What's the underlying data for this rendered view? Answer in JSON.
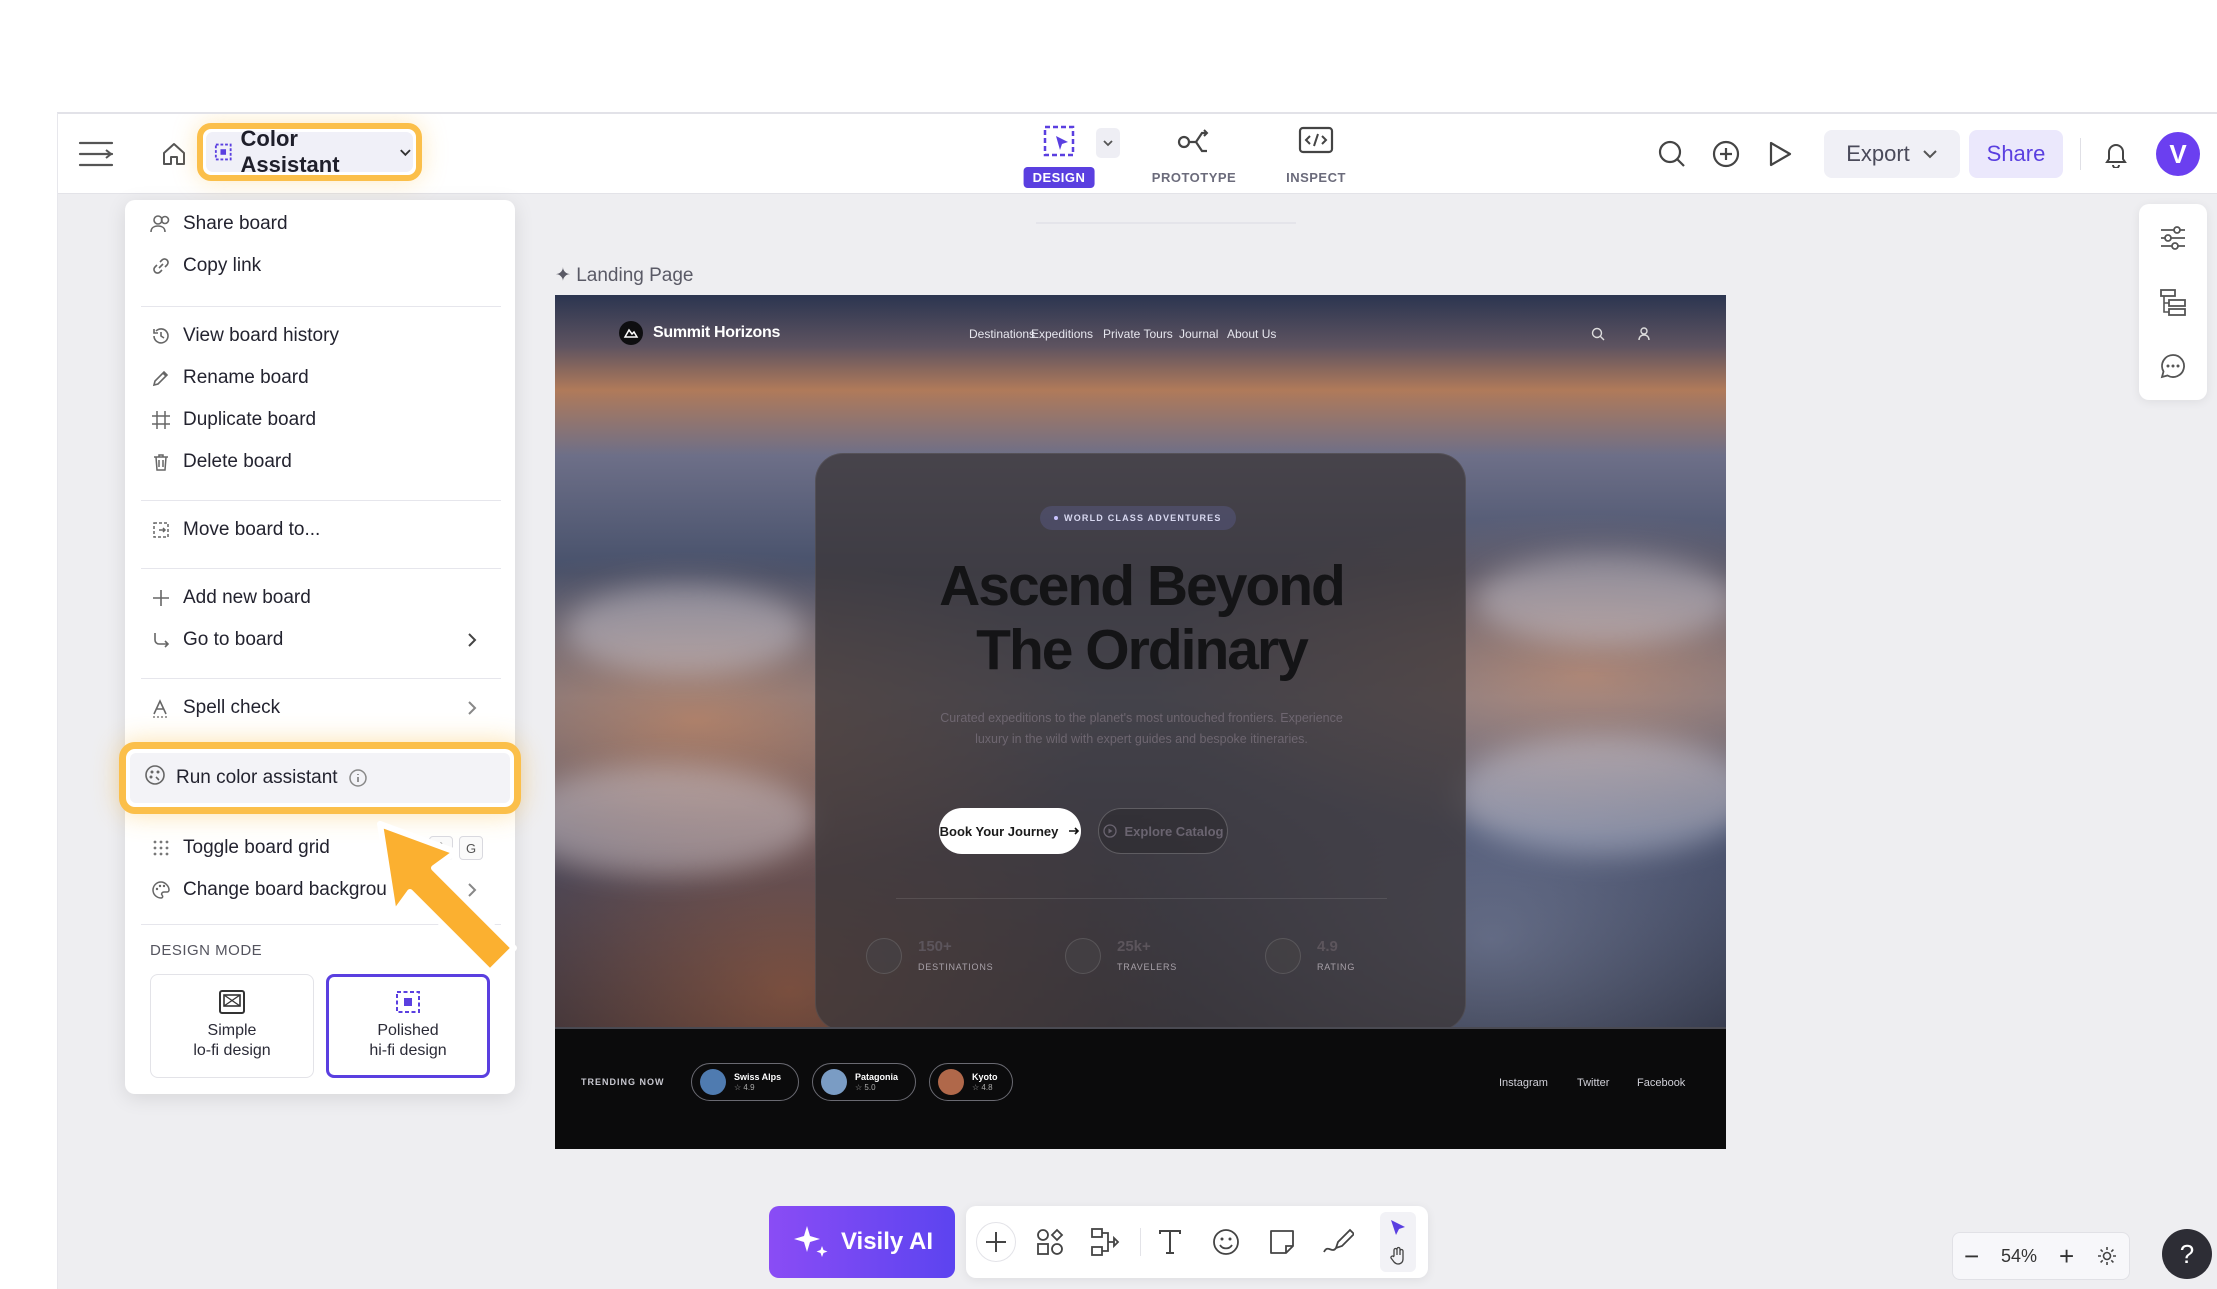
{
  "topbar": {
    "board_name": "Color Assistant",
    "modes": [
      {
        "label": "DESIGN",
        "active": true
      },
      {
        "label": "PROTOTYPE",
        "active": false
      },
      {
        "label": "INSPECT",
        "active": false
      }
    ],
    "export_label": "Export",
    "share_label": "Share",
    "avatar_initial": "V"
  },
  "menu": {
    "items": [
      {
        "label": "Share board",
        "icon": "share-users-icon"
      },
      {
        "label": "Copy link",
        "icon": "link-icon"
      },
      {
        "label": "View board history",
        "icon": "history-icon"
      },
      {
        "label": "Rename board",
        "icon": "pencil-icon"
      },
      {
        "label": "Duplicate board",
        "icon": "duplicate-icon"
      },
      {
        "label": "Delete board",
        "icon": "trash-icon"
      },
      {
        "label": "Move board to...",
        "icon": "move-icon"
      },
      {
        "label": "Add new board",
        "icon": "plus-icon"
      },
      {
        "label": "Go to board",
        "icon": "arrow-return-icon"
      },
      {
        "label": "Spell check",
        "icon": "spell-check-icon"
      },
      {
        "label": "Run color assistant",
        "icon": "color-palette-icon"
      },
      {
        "label": "Toggle board grid",
        "icon": "grid-icon",
        "shortcut": [
          "⇧",
          "G"
        ]
      },
      {
        "label": "Change board background",
        "icon": "palette-icon"
      }
    ],
    "design_mode_header": "DESIGN MODE",
    "design_modes": [
      {
        "line1": "Simple",
        "line2": "lo-fi design",
        "active": false
      },
      {
        "line1": "Polished",
        "line2": "hi-fi design",
        "active": true
      }
    ]
  },
  "canvas": {
    "frame_label": "Landing Page",
    "landing": {
      "brand": "Summit Horizons",
      "nav_links": [
        "Destinations",
        "Expeditions",
        "Private Tours",
        "Journal",
        "About Us"
      ],
      "badge": "WORLD CLASS ADVENTURES",
      "title_line1": "Ascend Beyond",
      "title_line2": "The Ordinary",
      "subtitle": "Curated expeditions to the planet's most untouched frontiers. Experience luxury in the wild with expert guides and bespoke itineraries.",
      "primary_cta": "Book Your Journey",
      "secondary_cta": "Explore Catalog",
      "stats": [
        {
          "value": "150+",
          "label": "DESTINATIONS"
        },
        {
          "value": "25k+",
          "label": "TRAVELERS"
        },
        {
          "value": "4.9",
          "label": "RATING"
        }
      ],
      "trending_label": "TRENDING NOW",
      "trending": [
        {
          "name": "Swiss Alps",
          "rating": "☆ 4.9",
          "color": "#4f7bb0"
        },
        {
          "name": "Patagonia",
          "rating": "☆ 5.0",
          "color": "#7a9cc4"
        },
        {
          "name": "Kyoto",
          "rating": "☆ 4.8",
          "color": "#b0684a"
        }
      ],
      "socials": [
        "Instagram",
        "Twitter",
        "Facebook"
      ]
    }
  },
  "bottom": {
    "ai_label": "Visily AI",
    "zoom": "54%",
    "help": "?"
  },
  "colors": {
    "accent": "#5a3fe0",
    "highlight": "#fbbf4a"
  }
}
